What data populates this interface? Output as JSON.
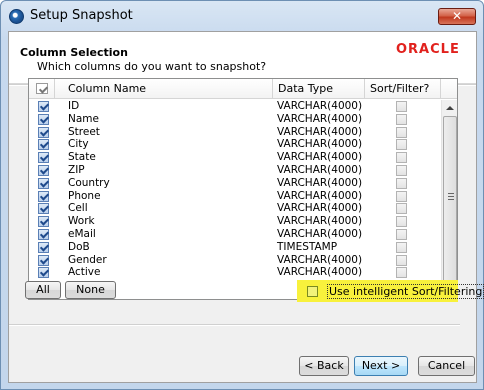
{
  "window": {
    "title": "Setup Snapshot",
    "close_glyph": "✕"
  },
  "header": {
    "title": "Column Selection",
    "subtitle": "Which columns do you want to snapshot?",
    "logo_text": "ORACLE",
    "logo_color": "#e1211d"
  },
  "table": {
    "columns": [
      "Column Name",
      "Data Type",
      "Sort/Filter?"
    ],
    "rows": [
      {
        "name": "ID",
        "type": "VARCHAR(4000)",
        "selected": true,
        "sort": false
      },
      {
        "name": "Name",
        "type": "VARCHAR(4000)",
        "selected": true,
        "sort": false
      },
      {
        "name": "Street",
        "type": "VARCHAR(4000)",
        "selected": true,
        "sort": false
      },
      {
        "name": "City",
        "type": "VARCHAR(4000)",
        "selected": true,
        "sort": false
      },
      {
        "name": "State",
        "type": "VARCHAR(4000)",
        "selected": true,
        "sort": false
      },
      {
        "name": "ZIP",
        "type": "VARCHAR(4000)",
        "selected": true,
        "sort": false
      },
      {
        "name": "Country",
        "type": "VARCHAR(4000)",
        "selected": true,
        "sort": false
      },
      {
        "name": "Phone",
        "type": "VARCHAR(4000)",
        "selected": true,
        "sort": false
      },
      {
        "name": "Cell",
        "type": "VARCHAR(4000)",
        "selected": true,
        "sort": false
      },
      {
        "name": "Work",
        "type": "VARCHAR(4000)",
        "selected": true,
        "sort": false
      },
      {
        "name": "eMail",
        "type": "VARCHAR(4000)",
        "selected": true,
        "sort": false
      },
      {
        "name": "DoB",
        "type": "TIMESTAMP",
        "selected": true,
        "sort": false
      },
      {
        "name": "Gender",
        "type": "VARCHAR(4000)",
        "selected": true,
        "sort": false
      },
      {
        "name": "Active",
        "type": "VARCHAR(4000)",
        "selected": true,
        "sort": false
      }
    ]
  },
  "selection_buttons": {
    "all": "All",
    "none": "None"
  },
  "intelligent_option": {
    "label": "Use intelligent Sort/Filtering",
    "checked": false,
    "highlight_color": "#f8f13c"
  },
  "footer": {
    "back": "< Back",
    "next": "Next >",
    "cancel": "Cancel"
  }
}
